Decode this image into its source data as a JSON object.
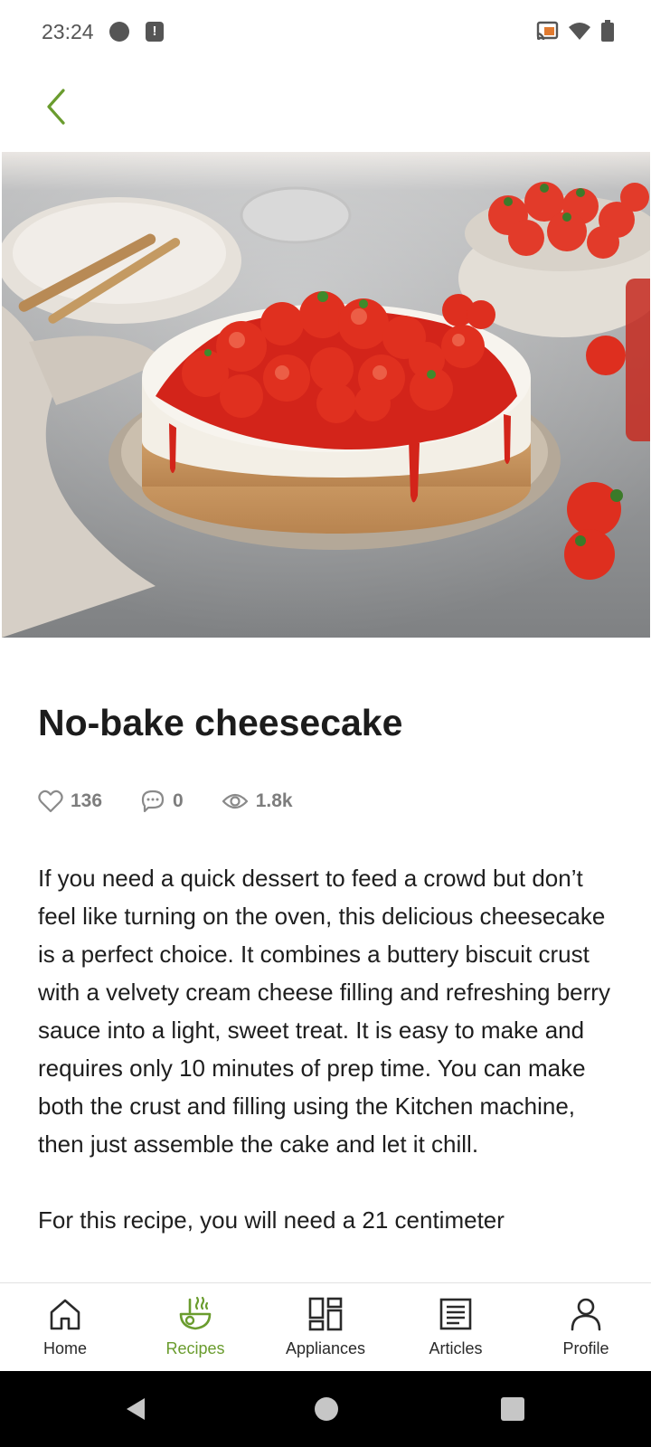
{
  "status_bar": {
    "time": "23:24"
  },
  "recipe": {
    "title": "No-bake cheesecake",
    "likes": "136",
    "comments": "0",
    "views": "1.8k",
    "description": [
      "If you need a quick dessert to feed a crowd but don’t feel like turning on the oven, this delicious cheesecake is a perfect choice. It combines a buttery biscuit crust with a velvety cream cheese filling and refreshing berry sauce into a light, sweet treat. It is easy to make and requires only 10 minutes of prep time. You can make both the crust and filling using the Kitchen machine, then just assemble the cake and let it chill.",
      "For this recipe, you will need a 21 centimeter"
    ]
  },
  "bottom_nav": {
    "items": [
      {
        "label": "Home",
        "icon": "home-icon"
      },
      {
        "label": "Recipes",
        "icon": "recipes-icon",
        "active": true
      },
      {
        "label": "Appliances",
        "icon": "appliances-icon"
      },
      {
        "label": "Articles",
        "icon": "articles-icon"
      },
      {
        "label": "Profile",
        "icon": "profile-icon"
      }
    ]
  },
  "colors": {
    "accent": "#6a9c2e",
    "text": "#1e1e1e",
    "muted": "#7d7d7d"
  }
}
